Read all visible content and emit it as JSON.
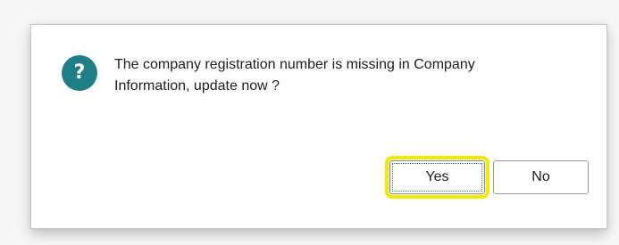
{
  "dialog": {
    "icon": "question-icon",
    "message_line1": "The company registration number is missing in Company",
    "message_line2": "Information, update now ?",
    "yes_label": "Yes",
    "no_label": "No"
  },
  "colors": {
    "icon_background": "#1e7f86",
    "highlight": "#f2ea00"
  }
}
